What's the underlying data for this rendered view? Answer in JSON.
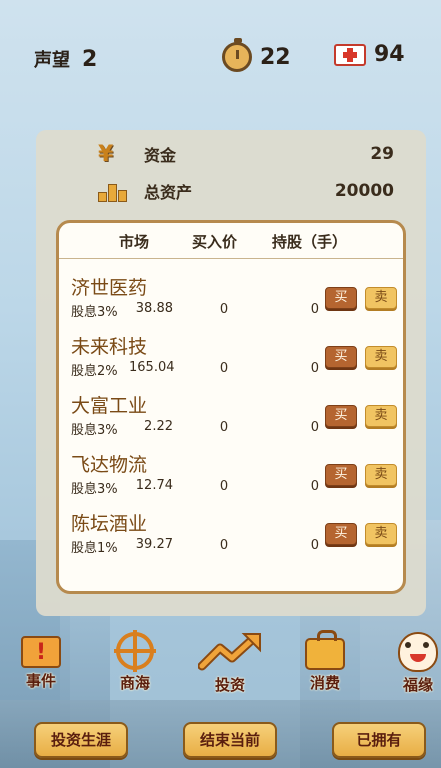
{
  "topbar": {
    "fame_label": "声望",
    "fame_value": "2",
    "time_icon": "stopwatch-icon",
    "time_value": "22",
    "health_icon": "red-cross-icon",
    "health_value": "94"
  },
  "assets": {
    "funds_label": "资金",
    "funds_value": "29",
    "total_label": "总资产",
    "total_value": "20000"
  },
  "market": {
    "headers": {
      "market": "市场",
      "buy_price": "买入价",
      "holding": "持股（手）"
    },
    "buy_label": "买",
    "sell_label": "卖",
    "stocks": [
      {
        "name": "济世医药",
        "dividend": "股息3%",
        "price": "38.88",
        "buy_price": "0",
        "holding": "0"
      },
      {
        "name": "未来科技",
        "dividend": "股息2%",
        "price": "165.04",
        "buy_price": "0",
        "holding": "0"
      },
      {
        "name": "大富工业",
        "dividend": "股息3%",
        "price": "2.22",
        "buy_price": "0",
        "holding": "0"
      },
      {
        "name": "飞达物流",
        "dividend": "股息3%",
        "price": "12.74",
        "buy_price": "0",
        "holding": "0"
      },
      {
        "name": "陈坛酒业",
        "dividend": "股息1%",
        "price": "39.27",
        "buy_price": "0",
        "holding": "0"
      }
    ]
  },
  "nav": {
    "events": "事件",
    "business": "商海",
    "invest": "投资",
    "consume": "消费",
    "fortune": "福缘"
  },
  "buttons": {
    "career": "投资生涯",
    "end_current": "结束当前",
    "owned": "已拥有"
  },
  "colors": {
    "accent_orange": "#d97f1e",
    "buy_button": "#b56530",
    "sell_button": "#f1c462",
    "stock_name": "#7a4a16"
  }
}
